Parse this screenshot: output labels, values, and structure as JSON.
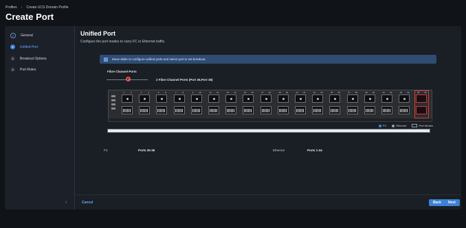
{
  "breadcrumb": [
    "Profiles",
    "Create UCS Domain Profile"
  ],
  "page_title": "Create Port",
  "steps": [
    {
      "num": "✓",
      "label": "General",
      "state": "done"
    },
    {
      "num": "2",
      "label": "Unified Port",
      "state": "active"
    },
    {
      "num": "3",
      "label": "Breakout Options",
      "state": "todo"
    },
    {
      "num": "4",
      "label": "Port Roles",
      "state": "todo"
    }
  ],
  "collapse_icon": "‹",
  "section": {
    "title": "Unified Port",
    "description": "Configure the port modes to carry FC or Ethernet traffic."
  },
  "banner": {
    "icon": "i",
    "text": "Move slider to configure unified ports and select port to set breakout."
  },
  "slider": {
    "label": "Fibre Channel Ports",
    "value_text": "2 Fibre Channel Ports (Port 35,Port 36)",
    "fc_ports": 2,
    "total_ports": 36
  },
  "switch": {
    "groups": [
      [
        "1",
        "2"
      ],
      [
        "3",
        "4"
      ],
      [
        "5",
        "6"
      ],
      [
        "7",
        "8"
      ],
      [
        "9",
        "10"
      ],
      [
        "11",
        "12"
      ],
      [
        "13",
        "14"
      ],
      [
        "15",
        "16"
      ],
      [
        "17",
        "18"
      ],
      [
        "19",
        "20"
      ],
      [
        "21",
        "22"
      ],
      [
        "23",
        "24"
      ],
      [
        "25",
        "26"
      ],
      [
        "27",
        "28"
      ],
      [
        "29",
        "30"
      ],
      [
        "31",
        "32"
      ],
      [
        "33",
        "34"
      ],
      [
        "35",
        "36"
      ]
    ],
    "fc_group_index": 17
  },
  "legend": [
    {
      "label": "FC",
      "color": "#3f86df"
    },
    {
      "label": "Ethernet",
      "color": "#9aa0a8"
    },
    {
      "label": "Port Modes",
      "color": "#9aa0a8"
    }
  ],
  "summary": {
    "fc_label": "FC",
    "fc_ports": "Ports 35-36",
    "eth_label": "Ethernet",
    "eth_ports": "Ports 1-34"
  },
  "footer": {
    "cancel": "Cancel",
    "back": "Back",
    "next": "Next"
  }
}
